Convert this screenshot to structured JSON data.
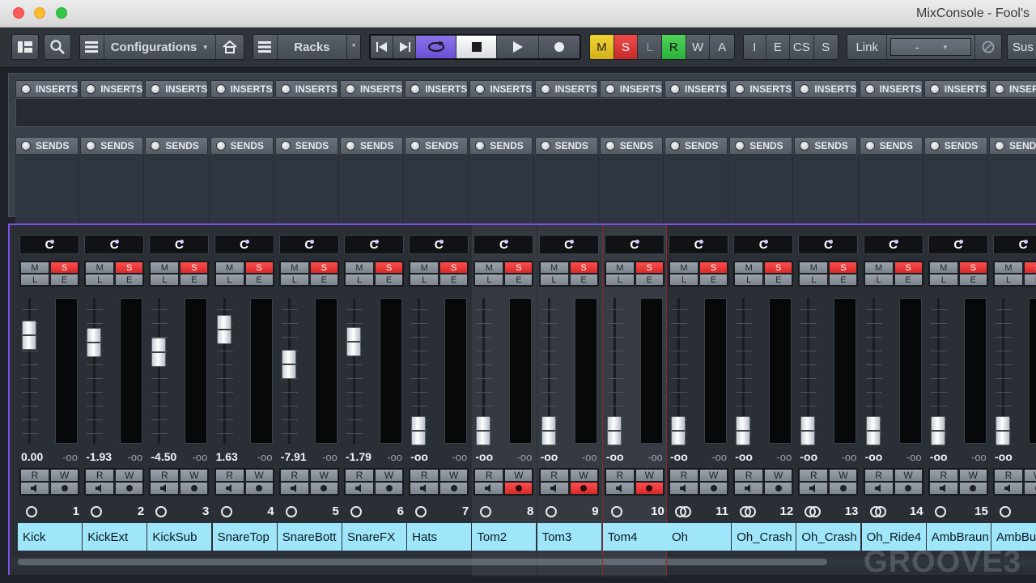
{
  "window": {
    "title": "MixConsole - Fool's"
  },
  "toolbar": {
    "configurations_label": "Configurations",
    "racks_label": "Racks",
    "racks_star": "*",
    "status_buttons": [
      "M",
      "S",
      "L",
      "R",
      "W",
      "A"
    ],
    "view_buttons": [
      "I",
      "E",
      "CS",
      "S"
    ],
    "link_label": "Link",
    "link_value": "-",
    "sus_label": "Sus",
    "icons": [
      "layout-icon",
      "search-icon",
      "list-icon",
      "home-icon",
      "racks-icon",
      "go-to-start-icon",
      "go-to-end-icon",
      "cycle-icon",
      "stop-icon",
      "play-icon",
      "record-icon",
      "suspend-icon"
    ]
  },
  "racks": {
    "inserts_label": "INSERTS",
    "sends_label": "SENDS"
  },
  "channels": [
    {
      "name": "Kick",
      "number": "1",
      "volume": "0.00",
      "peak": "-oo",
      "pan": "C",
      "linked": false,
      "armed": false
    },
    {
      "name": "KickExt",
      "number": "2",
      "volume": "-1.93",
      "peak": "-oo",
      "pan": "C",
      "linked": false,
      "armed": false
    },
    {
      "name": "KickSub",
      "number": "3",
      "volume": "-4.50",
      "peak": "-oo",
      "pan": "C",
      "linked": false,
      "armed": false
    },
    {
      "name": "SnareTop",
      "number": "4",
      "volume": "1.63",
      "peak": "-oo",
      "pan": "C",
      "linked": false,
      "armed": false
    },
    {
      "name": "SnareBott",
      "number": "5",
      "volume": "-7.91",
      "peak": "-oo",
      "pan": "C",
      "linked": false,
      "armed": false
    },
    {
      "name": "SnareFX",
      "number": "6",
      "volume": "-1.79",
      "peak": "-oo",
      "pan": "C",
      "linked": false,
      "armed": false
    },
    {
      "name": "Hats",
      "number": "7",
      "volume": "-oo",
      "peak": "-oo",
      "pan": "C",
      "linked": false,
      "armed": false
    },
    {
      "name": "Tom2",
      "number": "8",
      "volume": "-oo",
      "peak": "-oo",
      "pan": "C",
      "linked": false,
      "armed": true
    },
    {
      "name": "Tom3",
      "number": "9",
      "volume": "-oo",
      "peak": "-oo",
      "pan": "C",
      "linked": false,
      "armed": true
    },
    {
      "name": "Tom4",
      "number": "10",
      "volume": "-oo",
      "peak": "-oo",
      "pan": "C",
      "linked": false,
      "armed": true
    },
    {
      "name": "Oh",
      "number": "11",
      "volume": "-oo",
      "peak": "-oo",
      "pan": "C",
      "linked": true,
      "armed": false
    },
    {
      "name": "Oh_Crash",
      "number": "12",
      "volume": "-oo",
      "peak": "-oo",
      "pan": "C",
      "linked": true,
      "armed": false
    },
    {
      "name": "Oh_Crash",
      "number": "13",
      "volume": "-oo",
      "peak": "-oo",
      "pan": "C",
      "linked": true,
      "armed": false
    },
    {
      "name": "Oh_Ride4",
      "number": "14",
      "volume": "-oo",
      "peak": "-oo",
      "pan": "C",
      "linked": true,
      "armed": false
    },
    {
      "name": "AmbBraun",
      "number": "15",
      "volume": "-oo",
      "peak": "-oo",
      "pan": "C",
      "linked": false,
      "armed": false
    },
    {
      "name": "AmbBu",
      "number": "",
      "volume": "-oo",
      "peak": "-oo",
      "pan": "C",
      "linked": false,
      "armed": false
    }
  ],
  "strip_buttons": {
    "mute": "M",
    "solo": "S",
    "listen": "L",
    "edit": "E",
    "read": "R",
    "write": "W"
  },
  "watermark": "GROOVE3",
  "colors": {
    "accent": "#7d4fe6",
    "solo": "#e03a3a",
    "channel_name_bg": "#9fe6fb",
    "record": "#e03a3a"
  }
}
